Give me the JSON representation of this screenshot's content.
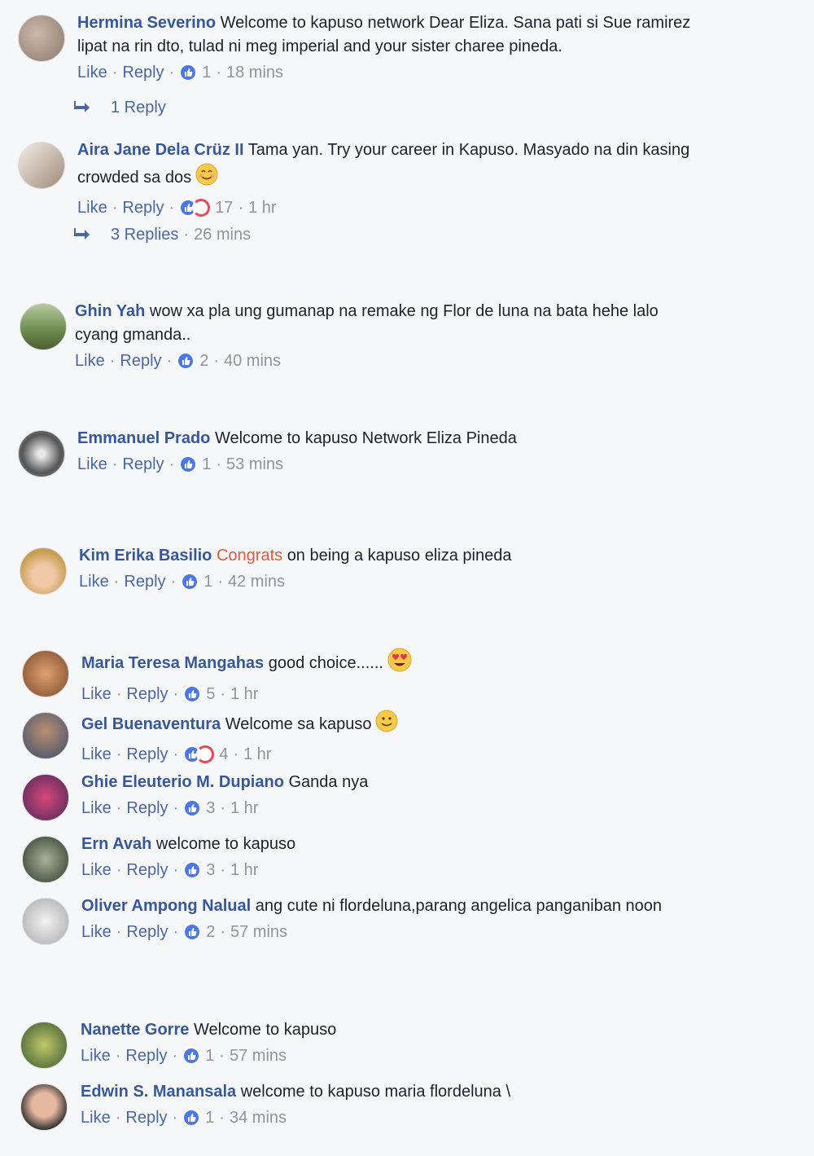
{
  "common": {
    "like": "Like",
    "reply": "Reply",
    "sep": "·"
  },
  "comments": [
    {
      "name": "Hermina Severino",
      "text": "Welcome to kapuso network Dear Eliza. Sana pati si Sue ramirez lipat na rin dto, tulad ni meg imperial and your sister charee pineda.",
      "count": "1",
      "time": "18 mins",
      "reactions": [
        "like"
      ],
      "replies": "1 Reply"
    },
    {
      "name": "Aira Jane Dela Crüz II",
      "text": "Tama yan. Try your career in Kapuso. Masyado na din kasing crowded sa dos",
      "emoji": "smile",
      "count": "17",
      "time": "1 hr",
      "reactions": [
        "like",
        "love"
      ],
      "replies": "3 Replies",
      "replies_time": "26 mins"
    },
    {
      "name": "Ghin Yah",
      "text": "wow xa pla ung gumanap na remake ng Flor de luna na bata hehe lalo cyang gmanda..",
      "count": "2",
      "time": "40 mins",
      "reactions": [
        "like"
      ]
    },
    {
      "name": "Emmanuel Prado",
      "text": "Welcome to kapuso Network Eliza Pineda",
      "count": "1",
      "time": "53 mins",
      "reactions": [
        "like"
      ]
    },
    {
      "name": "Kim Erika Basilio",
      "link": "Congrats",
      "text": "on being a kapuso eliza pineda",
      "count": "1",
      "time": "42 mins",
      "reactions": [
        "like"
      ]
    },
    {
      "name": "Maria Teresa Mangahas",
      "text": "good choice......",
      "emoji": "hearteyes",
      "count": "5",
      "time": "1 hr",
      "reactions": [
        "like"
      ]
    },
    {
      "name": "Gel Buenaventura",
      "text": "Welcome sa kapuso",
      "emoji": "slight",
      "count": "4",
      "time": "1 hr",
      "reactions": [
        "like",
        "love"
      ]
    },
    {
      "name": "Ghie Eleuterio M. Dupiano",
      "text": "Ganda nya",
      "count": "3",
      "time": "1 hr",
      "reactions": [
        "like"
      ]
    },
    {
      "name": "Ern Avah",
      "text": "welcome to kapuso",
      "count": "3",
      "time": "1 hr",
      "reactions": [
        "like"
      ]
    },
    {
      "name": "Oliver Ampong Nalual",
      "text": "ang cute ni flordeluna,parang angelica panganiban noon",
      "count": "2",
      "time": "57 mins",
      "reactions": [
        "like"
      ]
    },
    {
      "name": "Nanette Gorre",
      "text": "Welcome to kapuso",
      "count": "1",
      "time": "57 mins",
      "reactions": [
        "like"
      ]
    },
    {
      "name": "Edwin S. Manansala",
      "text": "welcome to kapuso maria flordeluna \\",
      "count": "1",
      "time": "34 mins",
      "reactions": [
        "like"
      ]
    }
  ],
  "colors": {
    "link": "#365899",
    "meta": "#90949c",
    "like": "#4a78e8",
    "love": "#e8475c",
    "background": "#f6f7f9"
  }
}
